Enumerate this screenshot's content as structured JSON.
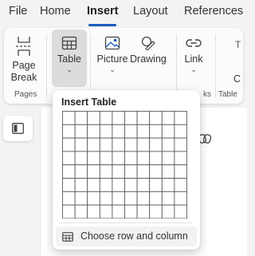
{
  "tabs": [
    {
      "label": "File"
    },
    {
      "label": "Home"
    },
    {
      "label": "Insert"
    },
    {
      "label": "Layout"
    },
    {
      "label": "References"
    }
  ],
  "ribbon": {
    "page_break": {
      "line1": "Page",
      "line2": "Break",
      "group": "Pages"
    },
    "table": {
      "label": "Table",
      "chevron": "⌄"
    },
    "picture": {
      "label": "Picture",
      "chevron": "⌄"
    },
    "drawing": {
      "label": "Drawing"
    },
    "link": {
      "label": "Link",
      "chevron": "⌄"
    },
    "group_links_partial": "ks",
    "group_tables_partial": "Table",
    "cutoff_icon_text": "T",
    "cutoff_label_text": "C"
  },
  "dropdown": {
    "title": "Insert Table",
    "grid": {
      "columns": 10,
      "rows": 8
    },
    "menu_item": "Choose row and column"
  },
  "colors": {
    "accent": "#185abd",
    "ribbon_bg": "#fbfbfb",
    "app_bg": "#f3f3f3"
  }
}
